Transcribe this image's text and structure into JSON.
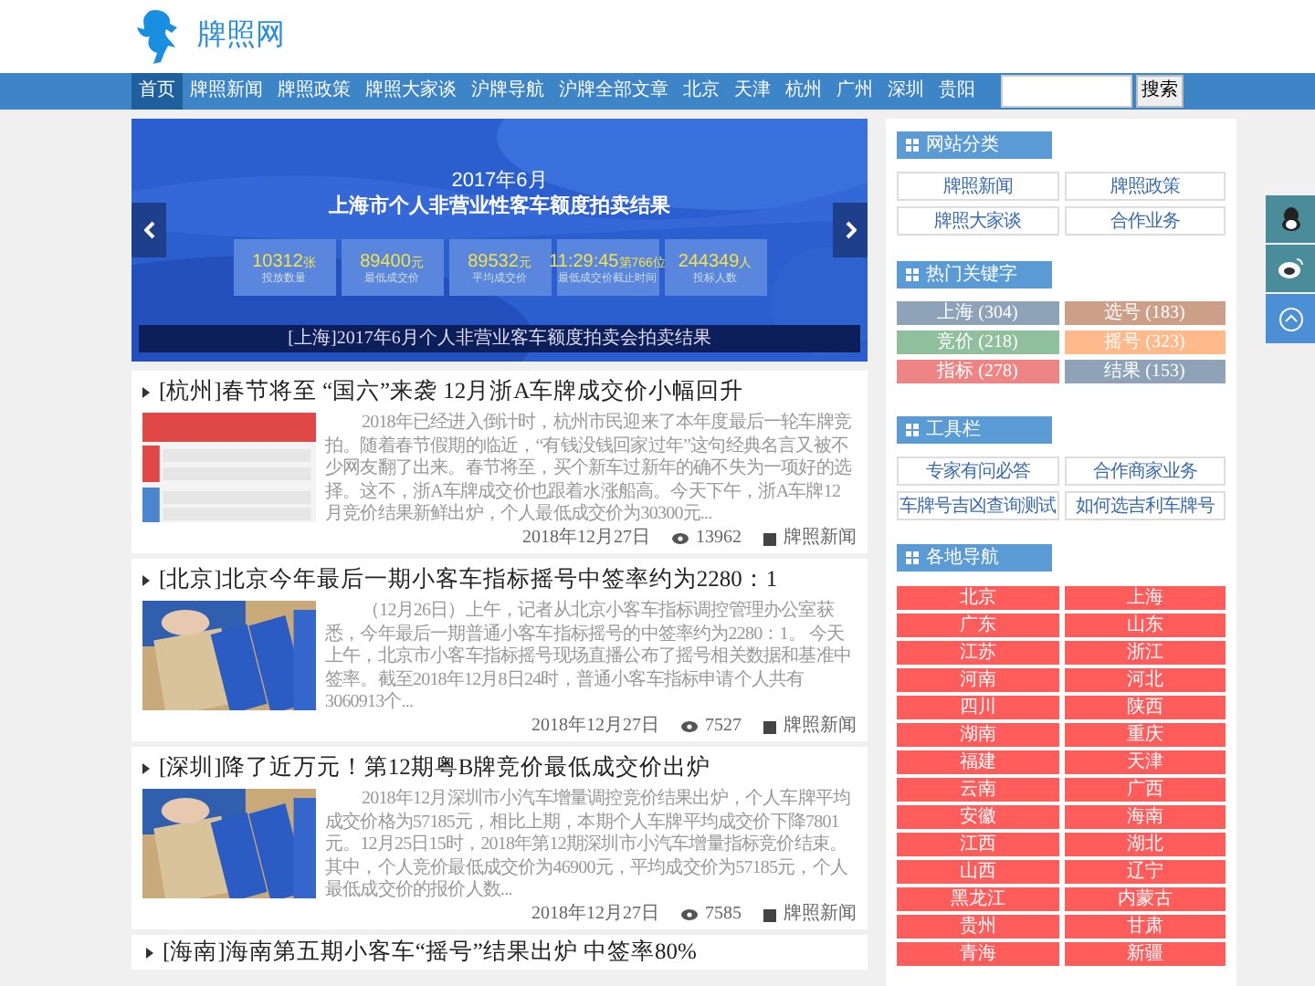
{
  "site": {
    "name": "牌照网"
  },
  "nav": {
    "items": [
      {
        "label": "首页",
        "selected": true
      },
      {
        "label": "牌照新闻",
        "selected": false
      },
      {
        "label": "牌照政策",
        "selected": false
      },
      {
        "label": "牌照大家谈",
        "selected": false
      },
      {
        "label": "沪牌导航",
        "selected": false
      },
      {
        "label": "沪牌全部文章",
        "selected": false
      },
      {
        "label": "北京",
        "selected": false
      },
      {
        "label": "天津",
        "selected": false
      },
      {
        "label": "杭州",
        "selected": false
      },
      {
        "label": "广州",
        "selected": false
      },
      {
        "label": "深圳",
        "selected": false
      },
      {
        "label": "贵阳",
        "selected": false
      }
    ],
    "search_button": "搜索"
  },
  "banner": {
    "year_month": "2017年6月",
    "headline": "上海市个人非营业性客车额度拍卖结果",
    "stats": [
      {
        "value": "10312",
        "unit": "张",
        "label": "投放数量"
      },
      {
        "value": "89400",
        "unit": "元",
        "label": "最低成交价"
      },
      {
        "value": "89532",
        "unit": "元",
        "label": "平均成交价"
      },
      {
        "value": "11:29:45",
        "unit": "第766位",
        "label": "最低成交价截止时间"
      },
      {
        "value": "244349",
        "unit": "人",
        "label": "投标人数"
      }
    ],
    "caption": "[上海]2017年6月个人非营业客车额度拍卖会拍卖结果"
  },
  "articles": [
    {
      "title": "[杭州]春节将至 “国六”来袭 12月浙A车牌成交价小幅回升",
      "excerpt": "2018年已经进入倒计时，杭州市民迎来了本年度最后一轮车牌竞拍。随着春节假期的临近，“有钱没钱回家过年”这句经典名言又被不少网友翻了出来。春节将至，买个新车过新年的确不失为一项好的选择。这不，浙A车牌成交价也跟着水涨船高。今天下午，浙A车牌12月竞价结果新鲜出炉，个人最低成交价为30300元...",
      "date": "2018年12月27日",
      "views": "13962",
      "category": "牌照新闻"
    },
    {
      "title": "[北京]北京今年最后一期小客车指标摇号中签率约为2280：1",
      "excerpt": "（12月26日）上午，记者从北京小客车指标调控管理办公室获悉，今年最后一期普通小客车指标摇号的中签率约为2280：1。 今天上午，北京市小客车指标摇号现场直播公布了摇号相关数据和基准中签率。截至2018年12月8日24时，普通小客车指标申请个人共有3060913个...",
      "date": "2018年12月27日",
      "views": "7527",
      "category": "牌照新闻"
    },
    {
      "title": "[深圳]降了近万元！第12期粤B牌竞价最低成交价出炉",
      "excerpt": "2018年12月深圳市小汽车增量调控竞价结果出炉，个人车牌平均成交价格为57185元，相比上期，本期个人车牌平均成交价下降7801元。12月25日15时，2018年第12期深圳市小汽车增量指标竞价结束。其中，个人竞价最低成交价为46900元，平均成交价为57185元，个人最低成交价的报价人数...",
      "date": "2018年12月27日",
      "views": "7585",
      "category": "牌照新闻"
    },
    {
      "title": "[海南]海南第五期小客车“摇号”结果出炉 中签率80%"
    }
  ],
  "sidebar": {
    "categories": {
      "title": "网站分类",
      "links": [
        "牌照新闻",
        "牌照政策",
        "牌照大家谈",
        "合作业务"
      ]
    },
    "keywords": {
      "title": "热门关键字",
      "tags": [
        {
          "label": "上海 (304)",
          "color": "#8fa3b8"
        },
        {
          "label": "选号 (183)",
          "color": "#cc9f88"
        },
        {
          "label": "竞价 (218)",
          "color": "#8fbf9c"
        },
        {
          "label": "摇号 (323)",
          "color": "#ffb98a"
        },
        {
          "label": "指标 (278)",
          "color": "#ee8585"
        },
        {
          "label": "结果 (153)",
          "color": "#8fa3b8"
        }
      ]
    },
    "tools": {
      "title": "工具栏",
      "links": [
        "专家有问必答",
        "合作商家业务",
        "车牌号吉凶查询测试",
        "如何选吉利车牌号"
      ]
    },
    "regions": {
      "title": "各地导航",
      "links": [
        "北京",
        "上海",
        "广东",
        "山东",
        "江苏",
        "浙江",
        "河南",
        "河北",
        "四川",
        "陕西",
        "湖南",
        "重庆",
        "福建",
        "天津",
        "云南",
        "广西",
        "安徽",
        "海南",
        "江西",
        "湖北",
        "山西",
        "辽宁",
        "黑龙江",
        "内蒙古",
        "贵州",
        "甘肃",
        "青海",
        "新疆"
      ]
    }
  }
}
